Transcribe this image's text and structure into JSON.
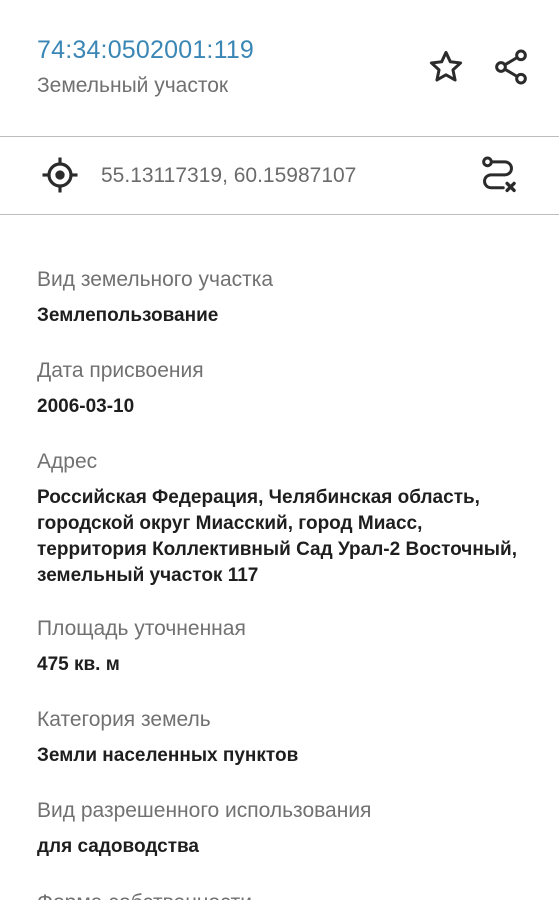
{
  "header": {
    "cadastral_number": "74:34:0502001:119",
    "object_type": "Земельный участок",
    "favorite_icon": "star-icon",
    "share_icon": "share-icon"
  },
  "coordinates": {
    "value": "55.13117319, 60.15987107",
    "locate_icon": "crosshair-icon",
    "route_icon": "route-icon"
  },
  "fields": [
    {
      "label": "Вид земельного участка",
      "value": "Землепользование"
    },
    {
      "label": "Дата присвоения",
      "value": "2006-03-10"
    },
    {
      "label": "Адрес",
      "value": "Российская Федерация, Челябинская область, городской округ Миасский, город Миасс, территория Коллективный Сад Урал-2 Восточный, земельный участок 117"
    },
    {
      "label": "Площадь уточненная",
      "value": "475 кв. м"
    },
    {
      "label": "Категория земель",
      "value": "Земли населенных пунктов"
    },
    {
      "label": "Вид разрешенного использования",
      "value": "для садоводства"
    }
  ],
  "partial_next_label": "Форма собственности",
  "colors": {
    "accent": "#3a86b5",
    "label": "#717171",
    "value": "#1e1e1e",
    "divider": "#bdbdbd"
  }
}
